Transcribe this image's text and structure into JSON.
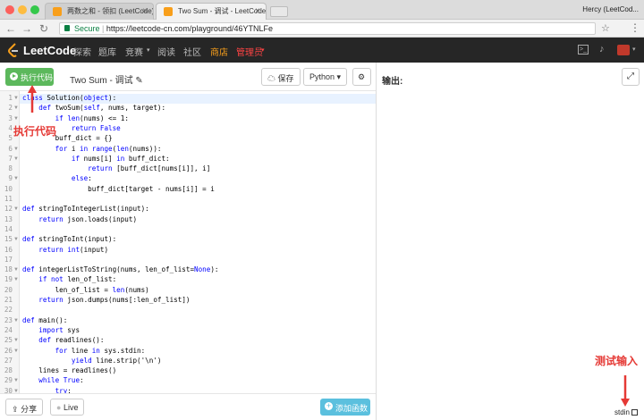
{
  "browser": {
    "tabs": [
      {
        "title": "两数之和 - 领扣 (LeetCode)"
      },
      {
        "title": "Two Sum - 调试 - LeetCode Pl"
      }
    ],
    "profile": "Hercy (LeetCod...",
    "address": {
      "secure_label": "Secure",
      "separator": " | ",
      "url": "https://leetcode-cn.com/playground/46YTNLFe"
    }
  },
  "site_nav": {
    "logo": "LeetCode",
    "items": [
      "探索",
      "题库",
      "竞赛",
      "阅读",
      "社区",
      "商店",
      "管理员"
    ]
  },
  "toolbar": {
    "run_label": "执行代码",
    "title": "Two Sum - 调试",
    "save_label": "保存",
    "language": "Python"
  },
  "editor": {
    "line_numbers": [
      "1",
      "2",
      "3",
      "4",
      "5",
      "6",
      "7",
      "8",
      "9",
      "10",
      "11",
      "12",
      "13",
      "14",
      "15",
      "16",
      "17",
      "18",
      "19",
      "20",
      "21",
      "22",
      "23",
      "24",
      "25",
      "26",
      "27",
      "28",
      "29",
      "30"
    ],
    "lines": [
      "class Solution(object):",
      "    def twoSum(self, nums, target):",
      "        if len(nums) <= 1:",
      "            return False",
      "        buff_dict = {}",
      "        for i in range(len(nums)):",
      "            if nums[i] in buff_dict:",
      "                return [buff_dict[nums[i]], i]",
      "            else:",
      "                buff_dict[target - nums[i]] = i",
      "",
      "def stringToIntegerList(input):",
      "    return json.loads(input)",
      "",
      "def stringToInt(input):",
      "    return int(input)",
      "",
      "def integerListToString(nums, len_of_list=None):",
      "    if not len_of_list:",
      "        len_of_list = len(nums)",
      "    return json.dumps(nums[:len_of_list])",
      "",
      "def main():",
      "    import sys",
      "    def readlines():",
      "        for line in sys.stdin:",
      "            yield line.strip('\\n')",
      "    lines = readlines()",
      "    while True:",
      "        try:"
    ]
  },
  "bottom_bar": {
    "share_label": "分享",
    "live_label": "Live",
    "add_function_label": "添加函数"
  },
  "output_panel": {
    "label": "输出:",
    "stdin_label": "stdin"
  },
  "annotations": {
    "run_code": "执行代码",
    "test_input": "测试输入"
  }
}
